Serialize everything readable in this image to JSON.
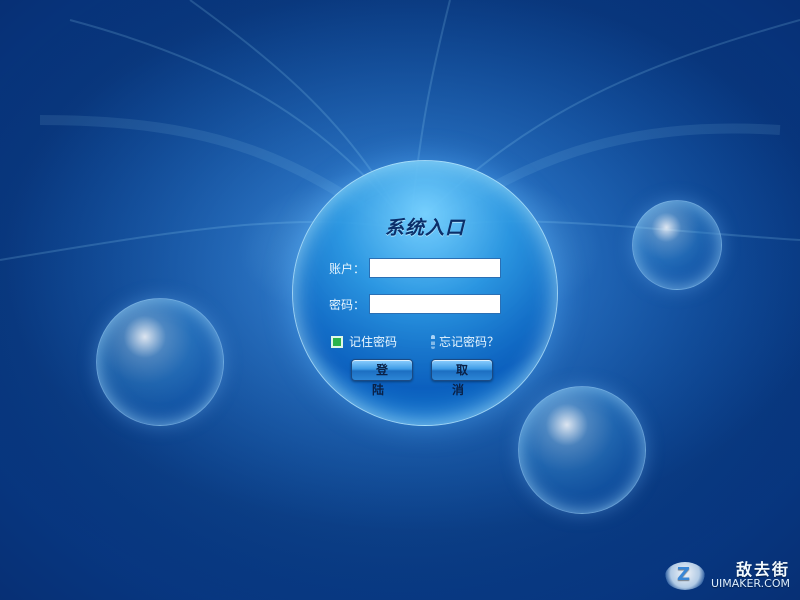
{
  "login": {
    "title": "系统入口",
    "account_label": "账户：",
    "account_value": "",
    "password_label": "密码：",
    "password_value": "",
    "remember_label": "记住密码",
    "remember_checked": true,
    "forgot_label": "忘记密码？",
    "login_button": "登 陆",
    "cancel_button": "取 消"
  },
  "watermark": {
    "site": "UIMAKER.COM",
    "chinese": "敌去街",
    "logo_letter": "Z"
  },
  "colors": {
    "background_dark": "#041a48",
    "background_mid": "#0a4fa8",
    "orb_light": "#78d2ff",
    "checkbox_green": "#2bb34b",
    "button_blue": "#3e9be6"
  },
  "icons": {
    "checkbox": "checkbox-checked-icon",
    "dotline": "dotted-separator-icon",
    "logo": "cloud-z-logo-icon"
  }
}
